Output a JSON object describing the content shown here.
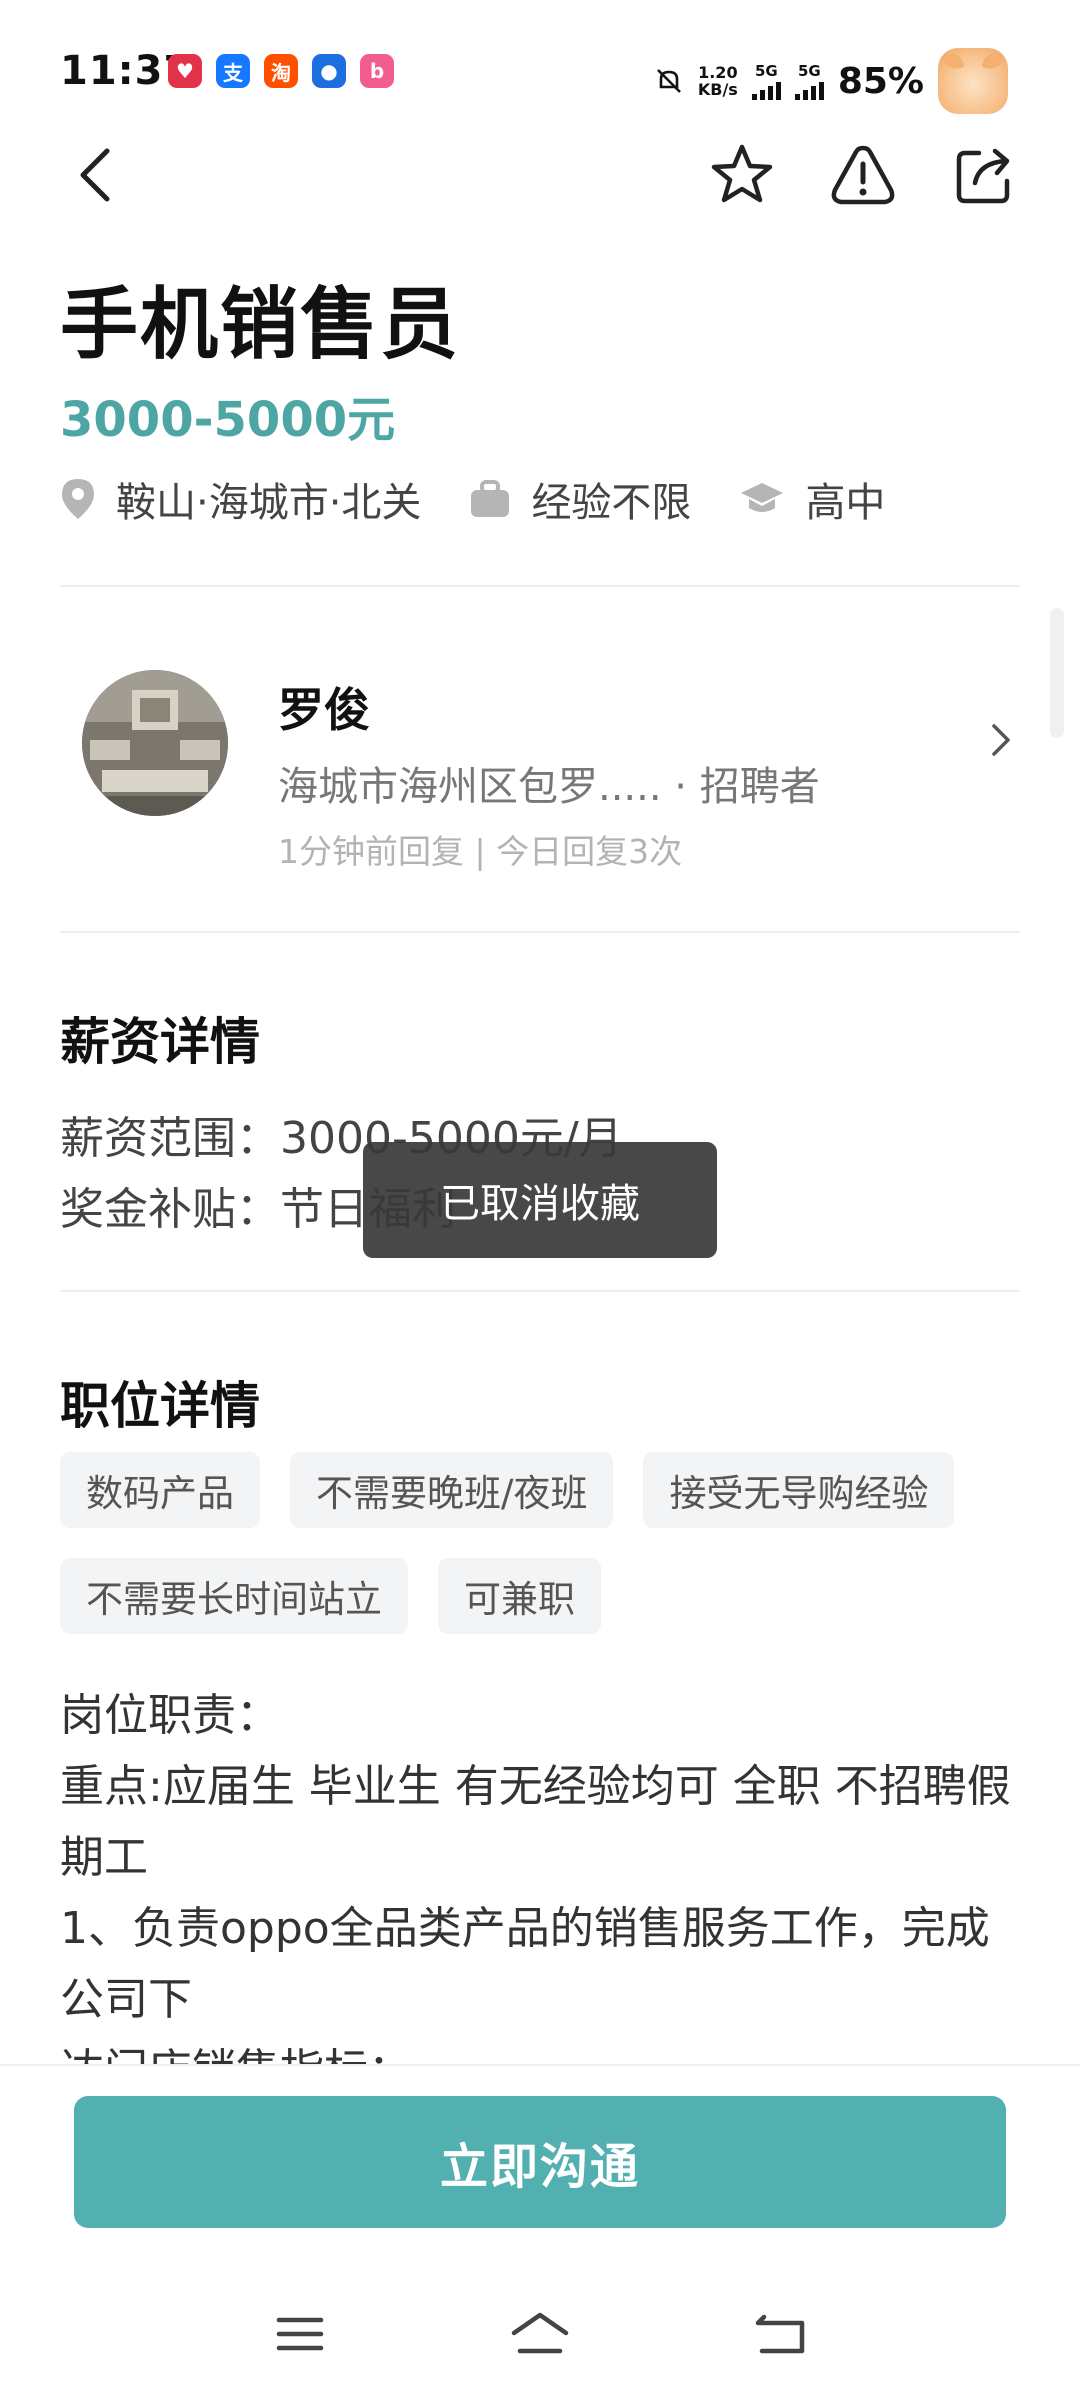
{
  "status_bar": {
    "time": "11:37",
    "net_speed_value": "1.20",
    "net_speed_unit": "KB/s",
    "sim1_label": "5G",
    "sim2_label": "5G",
    "battery": "85%",
    "app_icons": [
      {
        "name": "app-icon-red",
        "glyph": "♥",
        "color": "#e2324a"
      },
      {
        "name": "alipay-icon",
        "glyph": "支",
        "color": "#1677ff"
      },
      {
        "name": "taobao-icon",
        "glyph": "淘",
        "color": "#ff5000"
      },
      {
        "name": "app-icon-blue",
        "glyph": "●",
        "color": "#1d6fe0"
      },
      {
        "name": "bilibili-icon",
        "glyph": "b",
        "color": "#f25d8e"
      }
    ]
  },
  "job": {
    "title": "手机销售员",
    "salary": "3000-5000元",
    "location": "鞍山·海城市·北关",
    "experience": "经验不限",
    "education": "高中"
  },
  "recruiter": {
    "name": "罗俊",
    "company": "海城市海州区包罗..... · 招聘者",
    "reply_info": "1分钟前回复 | 今日回复3次"
  },
  "salary_details": {
    "heading": "薪资详情",
    "range": "薪资范围：3000-5000元/月",
    "bonus": "奖金补贴：节日福利"
  },
  "position_details": {
    "heading": "职位详情",
    "tags": [
      "数码产品",
      "不需要晚班/夜班",
      "接受无导购经验",
      "不需要长时间站立",
      "可兼职"
    ],
    "description": "岗位职责：\n重点:应届生 毕业生 有无经验均可 全职 不招聘假期工\n1、负责oppo全品类产品的销售服务工作，完成公司下\n达门店销售指标；"
  },
  "toast": {
    "text": "已取消收藏"
  },
  "bottom": {
    "chat_button": "立即沟通"
  },
  "colors": {
    "accent": "#52b0b0",
    "salary": "#4ea6a4"
  }
}
